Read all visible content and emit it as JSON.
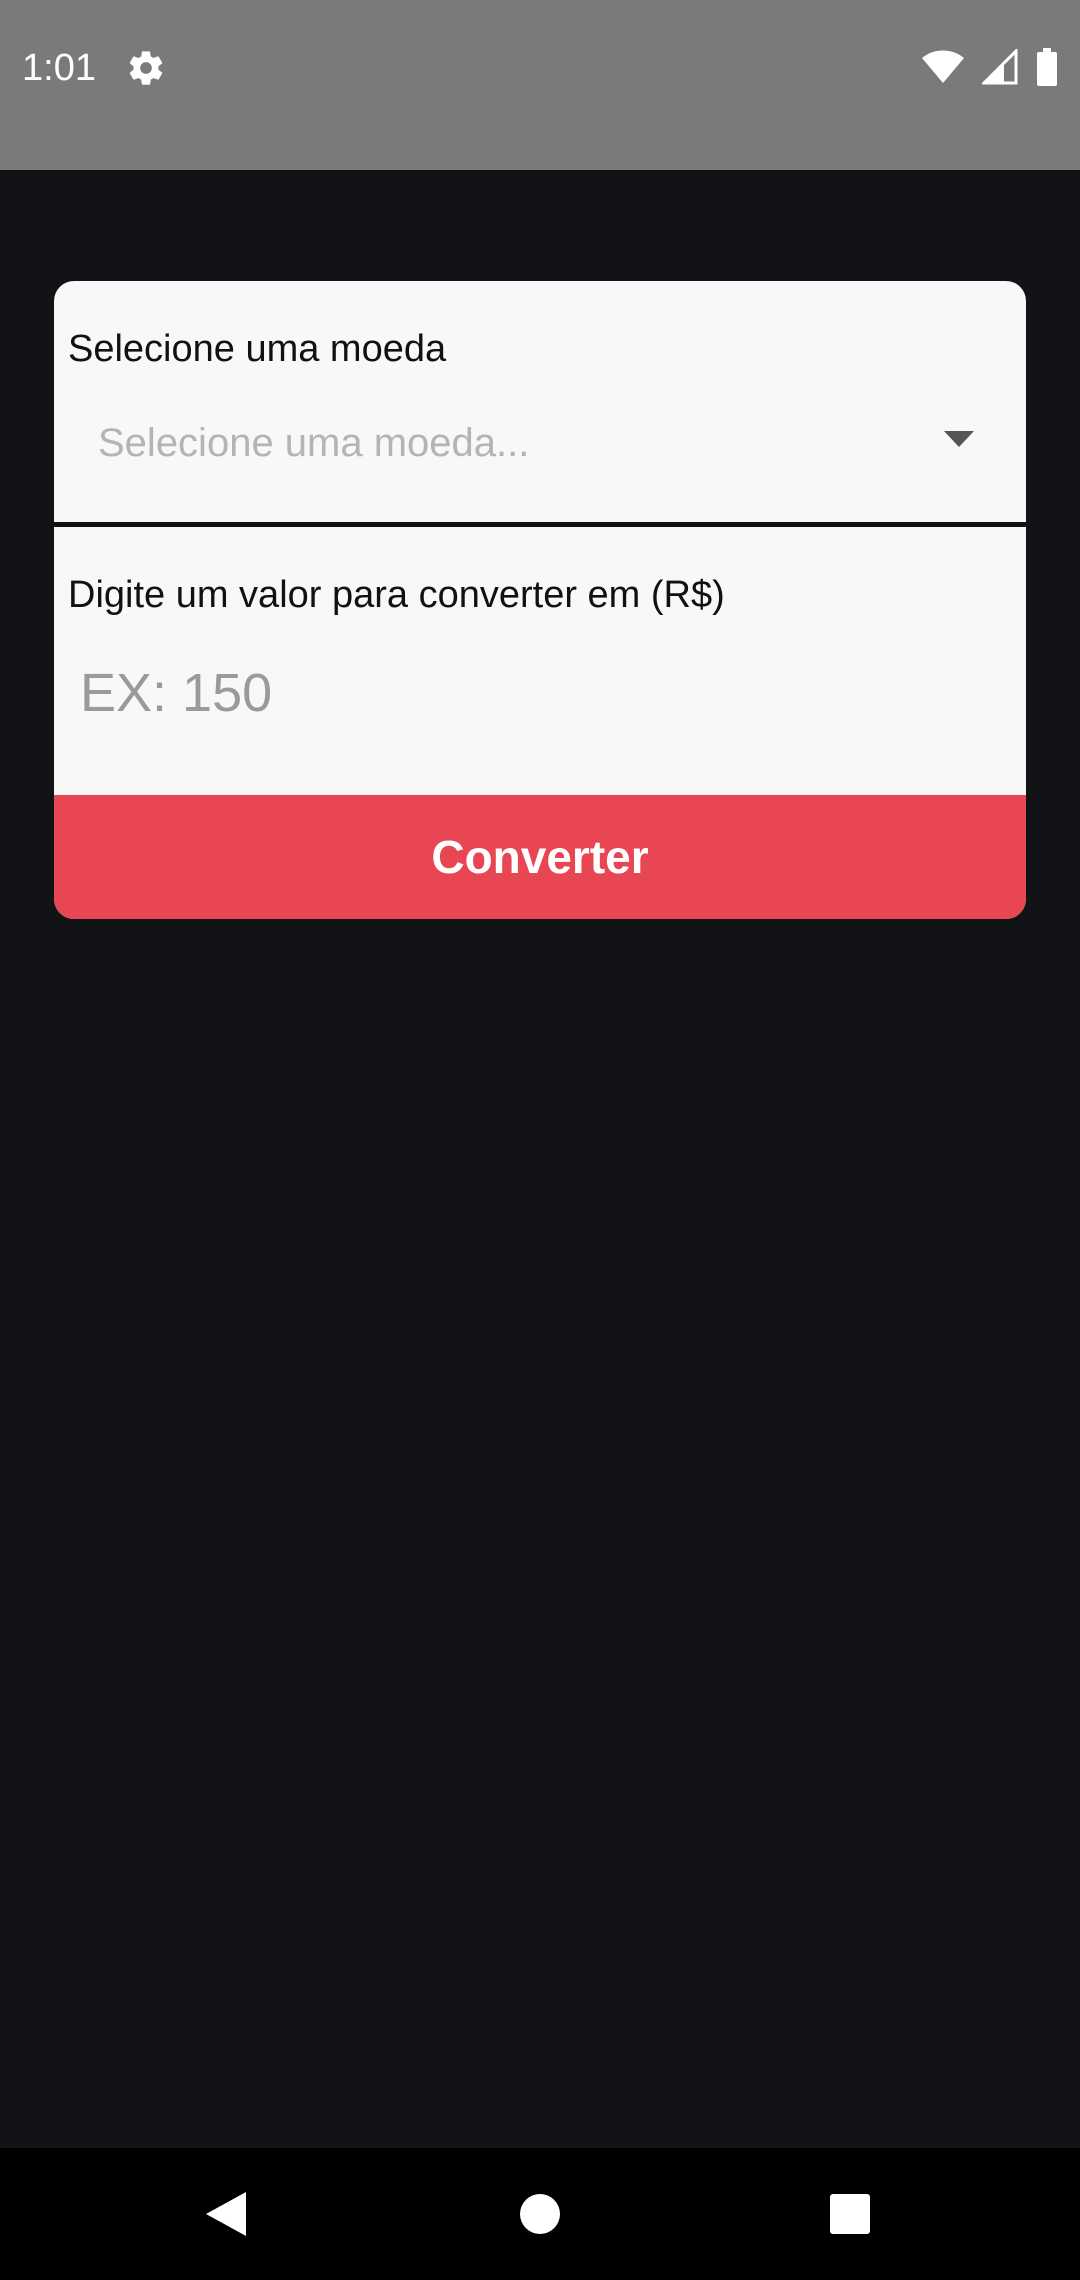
{
  "status_bar": {
    "time": "1:01",
    "left_icons": [
      "gear-icon"
    ],
    "right_icons": [
      "wifi-icon",
      "signal-icon",
      "battery-icon"
    ]
  },
  "form": {
    "currency_label": "Selecione uma moeda",
    "currency_picker": {
      "placeholder": "Selecione uma moeda...",
      "icon": "caret-down-icon"
    },
    "value_label": "Digite um valor para converter em (R$)",
    "value_input": {
      "placeholder": "EX: 150",
      "value": ""
    },
    "convert_label": "Converter"
  },
  "nav_bar": {
    "icons": [
      "back-icon",
      "home-icon",
      "recent-apps-icon"
    ]
  },
  "colors": {
    "status_bar_bg": "#7a7a7a",
    "background": "#121317",
    "card_bg": "#f8f8f8",
    "accent": "#e84653",
    "nav_bar_bg": "#000000"
  }
}
